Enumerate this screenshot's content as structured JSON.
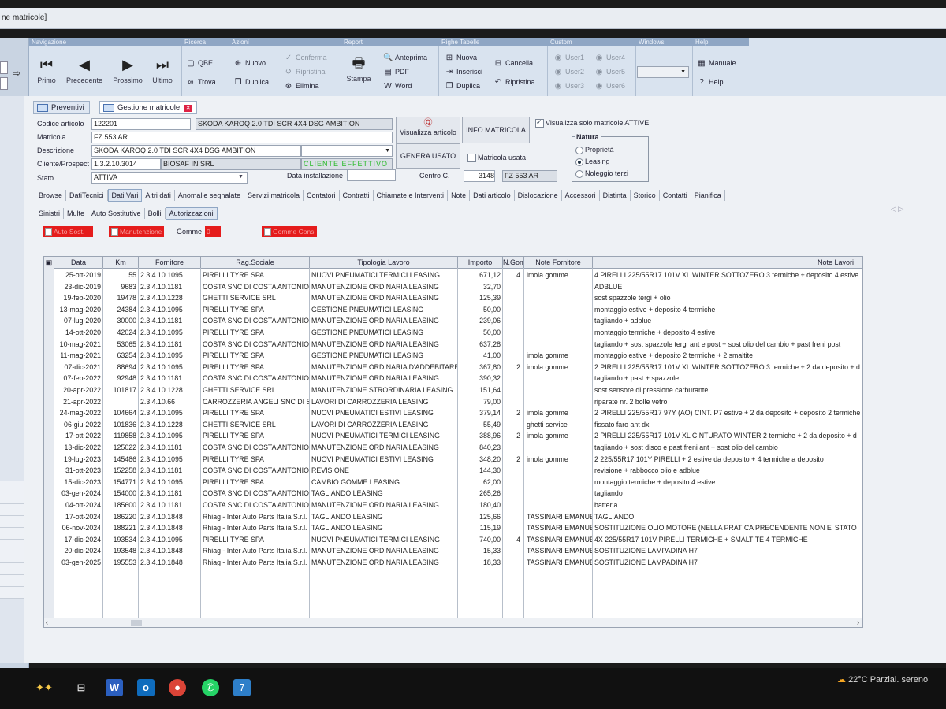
{
  "window": {
    "title": "ne matricole]"
  },
  "ribbon": {
    "groups": {
      "navigazione": "Navigazione",
      "ricerca": "Ricerca",
      "azioni": "Azioni",
      "report": "Report",
      "righe": "Righe Tabelle",
      "custom": "Custom",
      "windows": "Windows",
      "help": "Help"
    },
    "nav": {
      "primo": "Primo",
      "precedente": "Precedente",
      "prossimo": "Prossimo",
      "ultimo": "Ultimo"
    },
    "ricerca": {
      "qbe": "QBE",
      "trova": "Trova"
    },
    "azioni": {
      "nuovo": "Nuovo",
      "duplica": "Duplica",
      "conferma": "Conferma",
      "ripristina": "Ripristina",
      "elimina": "Elimina"
    },
    "report": {
      "stampa": "Stampa",
      "anteprima": "Anteprima",
      "pdf": "PDF",
      "word": "Word"
    },
    "righe": {
      "nuova": "Nuova",
      "inserisci": "Inserisci",
      "duplica": "Duplica",
      "cancella": "Cancella",
      "ripristina": "Ripristina"
    },
    "custom": [
      "User1",
      "User2",
      "User3",
      "User4",
      "User5",
      "User6"
    ],
    "help": {
      "manuale": "Manuale",
      "help": "Help"
    }
  },
  "doctabs": [
    "Preventivi",
    "Gestione matricole"
  ],
  "form": {
    "codice_articolo_label": "Codice articolo",
    "codice_articolo": "122201",
    "codice_desc": "SKODA KAROQ 2.0 TDI SCR 4X4 DSG AMBITION",
    "matricola_label": "Matricola",
    "matricola": "FZ 553 AR",
    "descrizione_label": "Descrizione",
    "descrizione": "SKODA KAROQ 2.0 TDI SCR 4X4 DSG AMBITION",
    "cliente_label": "Cliente/Prospect",
    "cliente_code": "1.3.2.10.3014",
    "cliente_name": "BIOSAF IN SRL",
    "cliente_status": "CLIENTE EFFETTIVO",
    "stato_label": "Stato",
    "stato": "ATTIVA",
    "data_installazione_label": "Data installazione",
    "centro_label": "Centro C.",
    "centro": "3148",
    "centro_targa": "FZ 553 AR",
    "visualizza_articolo": "Visualizza articolo",
    "info_matricola": "INFO MATRICOLA",
    "genera_usato": "GENERA USATO",
    "matricola_usata": "Matricola usata",
    "solo_attive": "Visualizza solo matricole ATTIVE",
    "natura_label": "Natura",
    "natura": [
      "Proprietà",
      "Leasing",
      "Noleggio terzi"
    ]
  },
  "tabs1": [
    "Browse",
    "DatiTecnici",
    "Dati Vari",
    "Altri dati",
    "Anomalie segnalate",
    "Servizi matricola",
    "Contatori",
    "Contratti",
    "Chiamate e Interventi",
    "Note",
    "Dati articolo",
    "Dislocazione",
    "Accessori",
    "Distinta",
    "Storico",
    "Contatti",
    "Pianifica"
  ],
  "tabs2": [
    "Sinistri",
    "Multe",
    "Auto Sostitutive",
    "Bolli",
    "Autorizzazioni"
  ],
  "flags": {
    "auto_sost": "Auto Sost.",
    "manutenzione": "Manutenzione",
    "gomme": "Gomme",
    "gomme_value": "0",
    "gomme_cons": "Gomme Cons."
  },
  "table": {
    "headers": [
      "Data",
      "Km",
      "Fornitore",
      "Rag.Sociale",
      "Tipologia Lavoro",
      "Importo",
      "N.Gom",
      "Note Fornitore",
      "Note Lavori"
    ],
    "rows": [
      [
        "25-ott-2019",
        "55",
        "2.3.4.10.1095",
        "PIRELLI TYRE SPA",
        "NUOVI PNEUMATICI TERMICI LEASING",
        "671,12",
        "4",
        "imola gomme",
        "4 PIRELLI 225/55R17 101V XL WINTER SOTTOZERO 3 termiche + deposito 4 estive"
      ],
      [
        "23-dic-2019",
        "9683",
        "2.3.4.10.1181",
        "COSTA SNC DI COSTA ANTONIO",
        "MANUTENZIONE ORDINARIA LEASING",
        "32,70",
        "",
        "",
        "ADBLUE"
      ],
      [
        "19-feb-2020",
        "19478",
        "2.3.4.10.1228",
        "GHETTI SERVICE SRL",
        "MANUTENZIONE ORDINARIA LEASING",
        "125,39",
        "",
        "",
        "sost spazzole tergi + olio"
      ],
      [
        "13-mag-2020",
        "24384",
        "2.3.4.10.1095",
        "PIRELLI TYRE SPA",
        "GESTIONE PNEUMATICI LEASING",
        "50,00",
        "",
        "",
        "montaggio estive + deposito 4 termiche"
      ],
      [
        "07-lug-2020",
        "30000",
        "2.3.4.10.1181",
        "COSTA SNC DI COSTA ANTONIO",
        "MANUTENZIONE ORDINARIA LEASING",
        "239,06",
        "",
        "",
        "tagliando + adblue"
      ],
      [
        "14-ott-2020",
        "42024",
        "2.3.4.10.1095",
        "PIRELLI TYRE SPA",
        "GESTIONE PNEUMATICI LEASING",
        "50,00",
        "",
        "",
        "montaggio termiche + deposito 4 estive"
      ],
      [
        "10-mag-2021",
        "53065",
        "2.3.4.10.1181",
        "COSTA SNC DI COSTA ANTONIO",
        "MANUTENZIONE ORDINARIA LEASING",
        "637,28",
        "",
        "",
        "tagliando + sost spazzole tergi ant e post + sost olio del cambio + past freni post"
      ],
      [
        "11-mag-2021",
        "63254",
        "2.3.4.10.1095",
        "PIRELLI TYRE SPA",
        "GESTIONE PNEUMATICI LEASING",
        "41,00",
        "",
        "imola gomme",
        "montaggio estive + deposito 2 termiche + 2 smaltite"
      ],
      [
        "07-dic-2021",
        "88694",
        "2.3.4.10.1095",
        "PIRELLI TYRE SPA",
        "MANUTENZIONE ORDINARIA D'ADDEBITARE",
        "367,80",
        "2",
        "imola gomme",
        "2 PIRELLI 225/55R17 101V XL WINTER SOTTOZERO 3 termiche + 2 da deposito + d"
      ],
      [
        "07-feb-2022",
        "92948",
        "2.3.4.10.1181",
        "COSTA SNC DI COSTA ANTONIO",
        "MANUTENZIONE ORDINARIA LEASING",
        "390,32",
        "",
        "",
        "tagliando + past + spazzole"
      ],
      [
        "20-apr-2022",
        "101817",
        "2.3.4.10.1228",
        "GHETTI SERVICE SRL",
        "MANUTENZIONE STRORDINARIA LEASING",
        "151,64",
        "",
        "",
        "sost sensore di pressione carburante"
      ],
      [
        "21-apr-2022",
        "",
        "2.3.4.10.66",
        "CARROZZERIA ANGELI SNC DI S",
        "LAVORI DI CARROZZERIA LEASING",
        "79,00",
        "",
        "",
        "riparate nr. 2 bolle vetro"
      ],
      [
        "24-mag-2022",
        "104664",
        "2.3.4.10.1095",
        "PIRELLI TYRE SPA",
        "NUOVI PNEUMATICI ESTIVI LEASING",
        "379,14",
        "2",
        "imola gomme",
        "2 PIRELLI 225/55R17 97Y (AO) CINT. P7 estive + 2 da deposito + deposito 2 termiche"
      ],
      [
        "06-giu-2022",
        "101836",
        "2.3.4.10.1228",
        "GHETTI SERVICE SRL",
        "LAVORI DI CARROZZERIA LEASING",
        "55,49",
        "",
        "ghetti service",
        "fissato faro ant dx"
      ],
      [
        "17-ott-2022",
        "119858",
        "2.3.4.10.1095",
        "PIRELLI TYRE SPA",
        "NUOVI PNEUMATICI TERMICI LEASING",
        "388,96",
        "2",
        "imola gomme",
        "2 PIRELLI 225/55R17 101V XL CINTURATO WINTER 2 termiche + 2 da deposito + d"
      ],
      [
        "13-dic-2022",
        "125022",
        "2.3.4.10.1181",
        "COSTA SNC DI COSTA ANTONIO",
        "MANUTENZIONE ORDINARIA LEASING",
        "840,23",
        "",
        "",
        "tagliando + sost disco e past freni ant + sost olio del cambio"
      ],
      [
        "19-lug-2023",
        "145486",
        "2.3.4.10.1095",
        "PIRELLI TYRE SPA",
        "NUOVI PNEUMATICI ESTIVI LEASING",
        "348,20",
        "2",
        "imola gomme",
        "2 225/55R17 101Y PIRELLI + 2 estive da deposito + 4 termiche a deposito"
      ],
      [
        "31-ott-2023",
        "152258",
        "2.3.4.10.1181",
        "COSTA SNC DI COSTA ANTONIO",
        "REVISIONE",
        "144,30",
        "",
        "",
        "revisione + rabbocco olio e adblue"
      ],
      [
        "15-dic-2023",
        "154771",
        "2.3.4.10.1095",
        "PIRELLI TYRE SPA",
        "CAMBIO GOMME LEASING",
        "62,00",
        "",
        "",
        "montaggio termiche + deposito 4 estive"
      ],
      [
        "03-gen-2024",
        "154000",
        "2.3.4.10.1181",
        "COSTA SNC DI COSTA ANTONIO",
        "TAGLIANDO LEASING",
        "265,26",
        "",
        "",
        "tagliando"
      ],
      [
        "04-ott-2024",
        "185600",
        "2.3.4.10.1181",
        "COSTA SNC DI COSTA ANTONIO",
        "MANUTENZIONE ORDINARIA LEASING",
        "180,40",
        "",
        "",
        "batteria"
      ],
      [
        "17-ott-2024",
        "186220",
        "2.3.4.10.1848",
        "Rhiag - Inter Auto Parts Italia S.r.l.",
        "TAGLIANDO LEASING",
        "125,66",
        "",
        "TASSINARI EMANUE",
        "TAGLIANDO"
      ],
      [
        "06-nov-2024",
        "188221",
        "2.3.4.10.1848",
        "Rhiag - Inter Auto Parts Italia S.r.l.",
        "TAGLIANDO LEASING",
        "115,19",
        "",
        "TASSINARI EMANUE",
        "SOSTITUZIONE OLIO MOTORE (NELLA PRATICA PRECENDENTE NON E' STATO"
      ],
      [
        "17-dic-2024",
        "193534",
        "2.3.4.10.1095",
        "PIRELLI TYRE SPA",
        "NUOVI PNEUMATICI TERMICI LEASING",
        "740,00",
        "4",
        "TASSINARI EMANUE",
        "4X 225/55R17 101V PIRELLI TERMICHE + SMALTITE 4 TERMICHE"
      ],
      [
        "20-dic-2024",
        "193548",
        "2.3.4.10.1848",
        "Rhiag - Inter Auto Parts Italia S.r.l.",
        "MANUTENZIONE ORDINARIA LEASING",
        "15,33",
        "",
        "TASSINARI EMANUE",
        "SOSTITUZIONE LAMPADINA H7"
      ],
      [
        "03-gen-2025",
        "195553",
        "2.3.4.10.1848",
        "Rhiag - Inter Auto Parts Italia S.r.l.",
        "MANUTENZIONE ORDINARIA LEASING",
        "18,33",
        "",
        "TASSINARI EMANUE",
        "SOSTITUZIONE LAMPADINA H7"
      ]
    ]
  },
  "taskbar": {
    "weather_temp": "22°C",
    "weather_desc": "Parzial. sereno"
  }
}
